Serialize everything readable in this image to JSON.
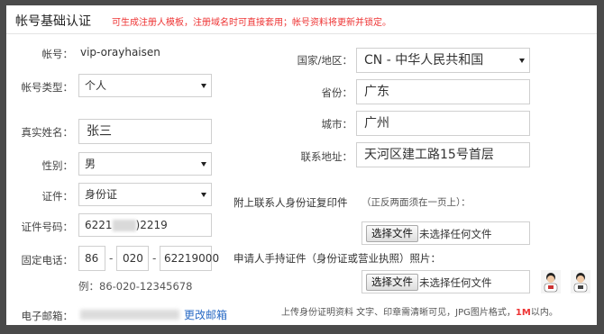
{
  "header": {
    "title": "帐号基础认证",
    "note": "可生成注册人模板，注册域名时可直接套用；帐号资料将更新并锁定。"
  },
  "left": {
    "account_label": "帐号：",
    "account_value": "vip-orayhaisen",
    "type_label": "帐号类型：",
    "type_value": "个人",
    "realname_label": "真实姓名：",
    "realname_value": "张三",
    "gender_label": "性别：",
    "gender_value": "男",
    "idtype_label": "证件：",
    "idtype_value": "身份证",
    "idnum_label": "证件号码：",
    "idnum_prefix": "6221",
    "idnum_suffix": ")2219",
    "phone_label": "固定电话：",
    "phone_area": "86",
    "phone_city": "020",
    "phone_number": "62219000",
    "phone_sep": "-",
    "phone_example": "例：86-020-12345678",
    "email_label": "电子邮箱：",
    "email_change": "更改邮箱"
  },
  "right": {
    "country_label": "国家/地区：",
    "country_value": "CN - 中华人民共和国",
    "province_label": "省份：",
    "province_value": "广东",
    "city_label": "城市：",
    "city_value": "广州",
    "address_label": "联系地址：",
    "address_value": "天河区建工路15号首层",
    "attach_id_label": "附上联系人身份证复印件",
    "attach_id_hint": "（正反两面须在一页上）：",
    "file_button": "选择文件",
    "file_none": "未选择任何文件",
    "attach_hold_label": "申请人手持证件（身份证或营业执照）照片：",
    "upload_note_a": "上传身份证明资料 文字、印章需清晰可见，JPG图片格式，",
    "upload_note_limit": "1M",
    "upload_note_b": "以内。"
  },
  "colors": {
    "note_red": "#e33333",
    "link_blue": "#2a6bc5",
    "limit_red": "#e33333"
  }
}
